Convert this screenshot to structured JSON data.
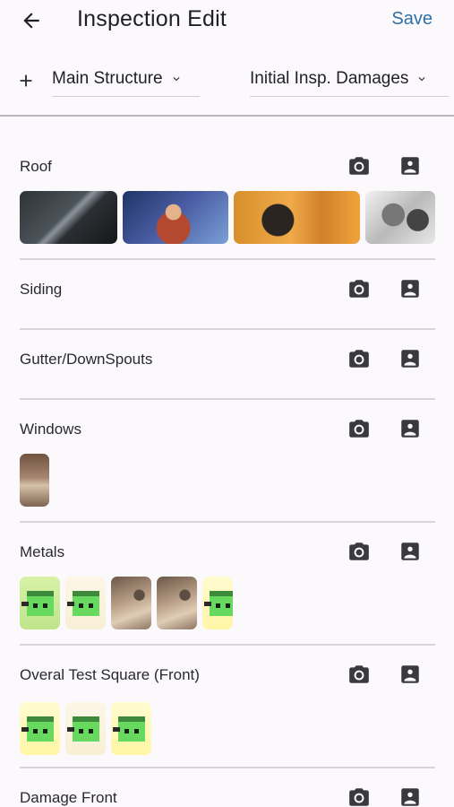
{
  "header": {
    "title": "Inspection Edit",
    "save_label": "Save"
  },
  "filters": {
    "structure": "Main Structure",
    "damage_type": "Initial Insp. Damages"
  },
  "sections": [
    {
      "label": "Roof",
      "photos": [
        "space-ship-photo",
        "man-drinking-photo",
        "orange-scene-photo",
        "comic-faces-photo"
      ]
    },
    {
      "label": "Siding",
      "photos": []
    },
    {
      "label": "Gutter/DownSpouts",
      "photos": []
    },
    {
      "label": "Windows",
      "photos": [
        "room-photo"
      ]
    },
    {
      "label": "Metals",
      "photos": [
        "green-sprite-photo",
        "green-sprite-photo",
        "room-photo",
        "room-photo",
        "green-sprite-photo"
      ]
    },
    {
      "label": "Overal Test Square (Front)",
      "photos": [
        "green-sprite-photo",
        "green-sprite-photo",
        "green-sprite-photo"
      ]
    },
    {
      "label": "Damage Front",
      "photos": []
    }
  ],
  "icons": {
    "back": "arrow-back-icon",
    "add": "plus-icon",
    "caret": "chevron-down-icon",
    "camera": "camera-icon",
    "library": "photo-library-icon"
  },
  "colors": {
    "accent": "#2f6fa8",
    "background": "#fbf9fc",
    "divider": "#d7d5da",
    "icon": "#3a3a3e"
  }
}
